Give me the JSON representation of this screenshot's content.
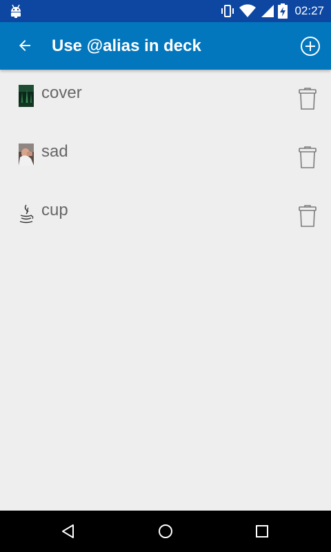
{
  "status_bar": {
    "time": "02:27",
    "icons": [
      "android-icon",
      "vibrate-icon",
      "wifi-icon",
      "signal-icon",
      "battery-charging-icon"
    ]
  },
  "app_bar": {
    "title": "Use @alias in deck",
    "back_icon": "arrow-back-icon",
    "add_icon": "add-circle-icon",
    "background": "#0277bd"
  },
  "aliases": [
    {
      "label": "cover",
      "thumb": "forest-cover-thumbnail",
      "action_icon": "trash-icon"
    },
    {
      "label": "sad",
      "thumb": "sad-person-thumbnail",
      "action_icon": "trash-icon"
    },
    {
      "label": "cup",
      "thumb": "java-cup-icon",
      "action_icon": "trash-icon"
    }
  ],
  "nav_bar": {
    "icons": [
      "back-triangle-icon",
      "home-circle-icon",
      "recents-square-icon"
    ]
  }
}
